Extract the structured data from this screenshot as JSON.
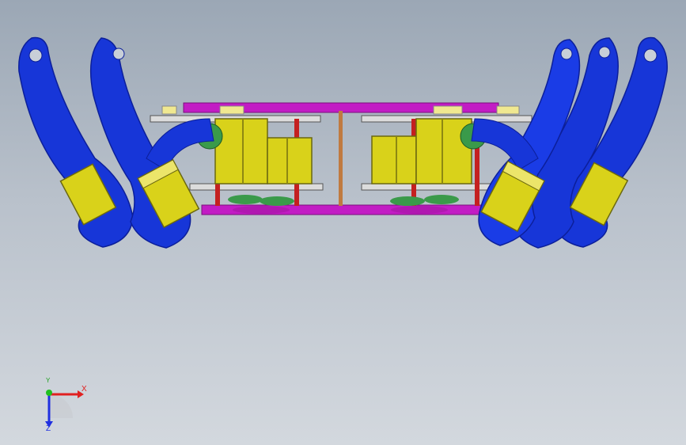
{
  "viewport": {
    "background_top": "#9ba7b5",
    "background_bottom": "#d3d8de"
  },
  "colors": {
    "leg_blue": "#1736d8",
    "leg_dark": "#0c1f9a",
    "servo_yellow": "#d9d21a",
    "servo_dark": "#8d8812",
    "plate_magenta": "#c21cc4",
    "rod_red": "#c42020",
    "rod_copper": "#c07a40",
    "hub_green": "#3a9a4a"
  },
  "triad": {
    "x_label": "X",
    "y_label": "Y",
    "z_label": "Z",
    "x_color": "#e02020",
    "y_color": "#20c020",
    "z_color": "#2030e0"
  }
}
